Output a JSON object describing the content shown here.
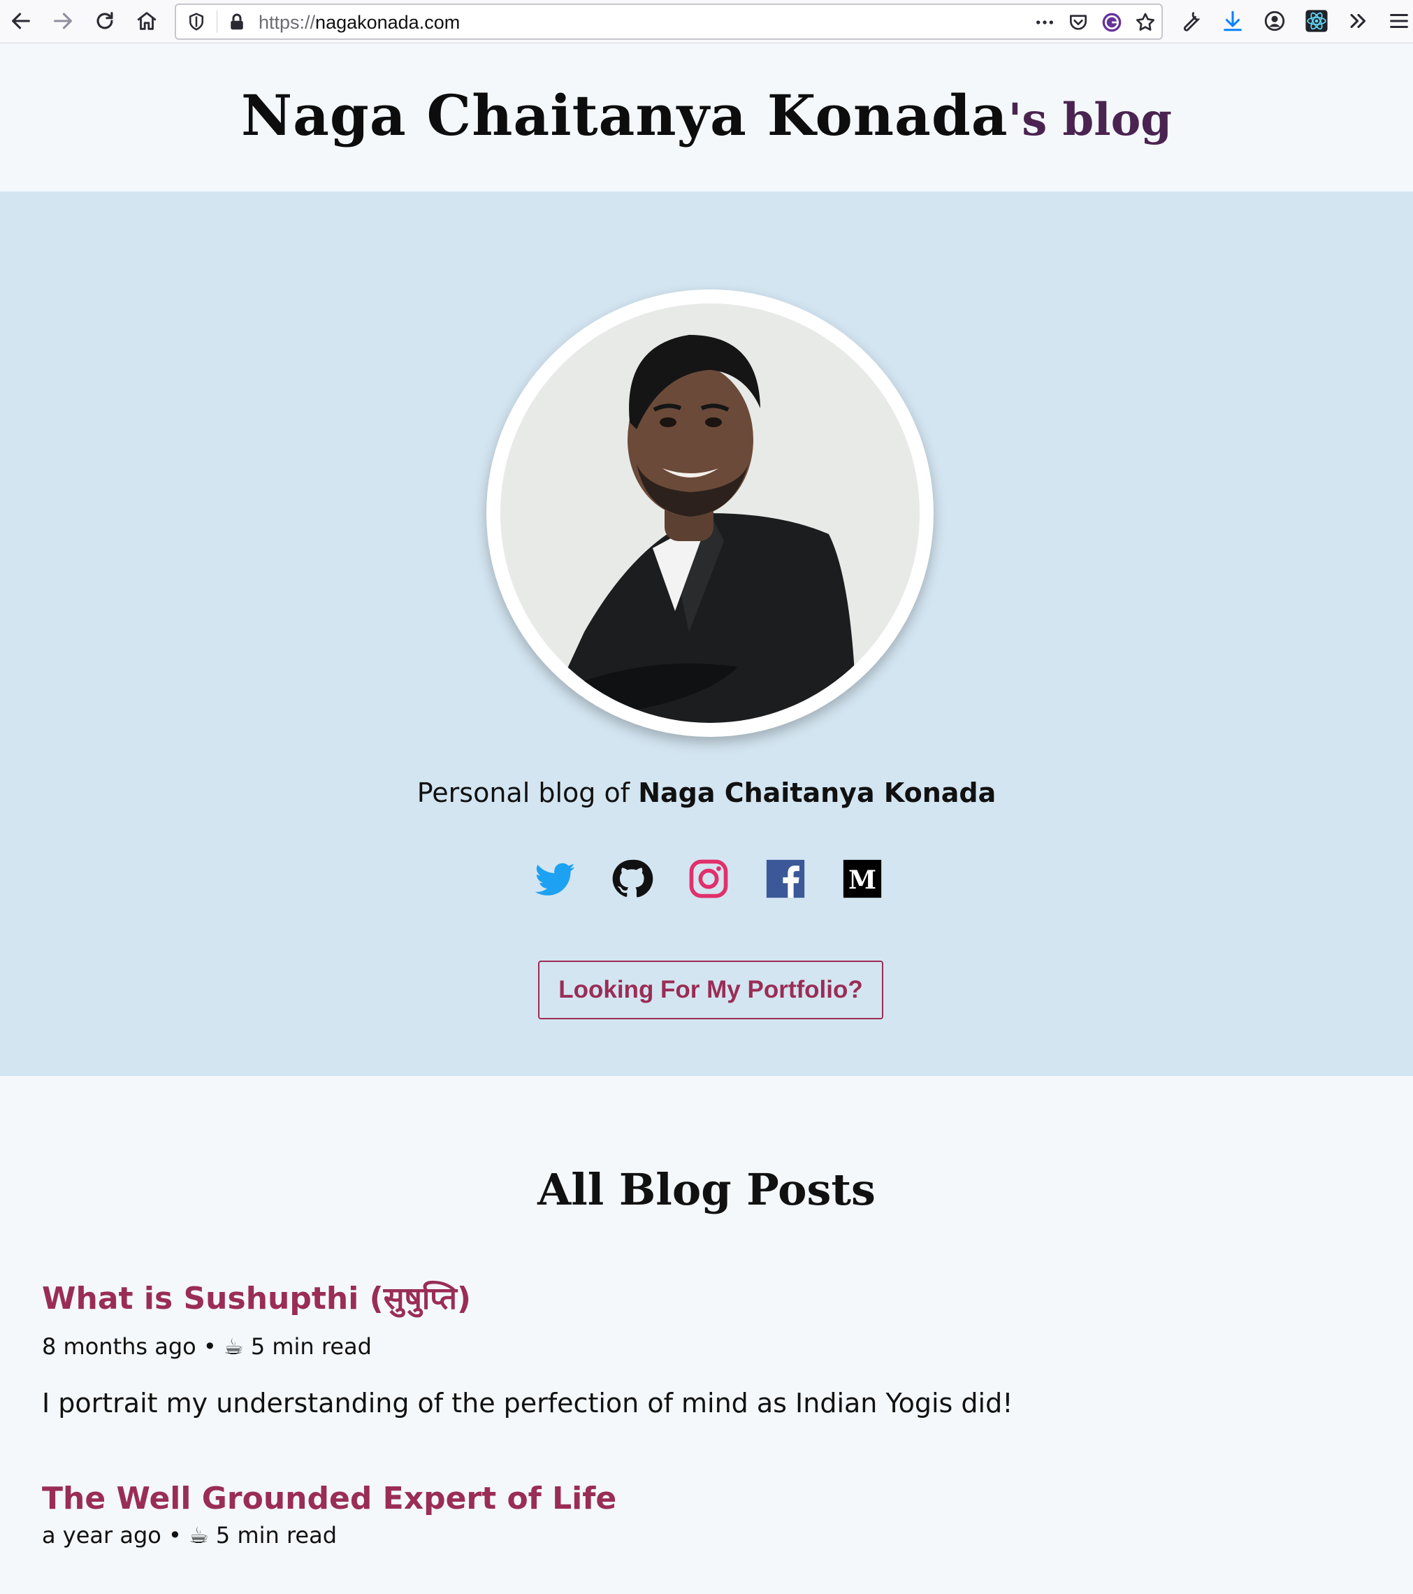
{
  "browser": {
    "url_scheme": "https://",
    "url_host": "nagakonada.com"
  },
  "header": {
    "name": "Naga Chaitanya Konada",
    "suffix": "'s blog"
  },
  "hero": {
    "intro_prefix": "Personal blog of ",
    "intro_name": "Naga Chaitanya Konada",
    "portfolio_button": "Looking For My Portfolio?",
    "socials": [
      "twitter",
      "github",
      "instagram",
      "facebook",
      "medium"
    ]
  },
  "posts": {
    "heading": "All Blog Posts",
    "items": [
      {
        "title": "What is Sushupthi (सुषुप्ति)",
        "date": "8 months ago",
        "dot": "•",
        "coffee": "☕",
        "read": "5 min read",
        "excerpt": "I portrait my understanding of the perfection of mind as Indian Yogis did!"
      },
      {
        "title": "The Well Grounded Expert of Life",
        "date": "a year ago",
        "dot": "•",
        "coffee": "☕",
        "read": "5 min read",
        "excerpt": ""
      }
    ]
  },
  "colors": {
    "accent": "#9a2d55",
    "hero_bg": "#d3e5f1",
    "page_bg": "#f4f8fb",
    "title_suffix": "#4a2350"
  }
}
